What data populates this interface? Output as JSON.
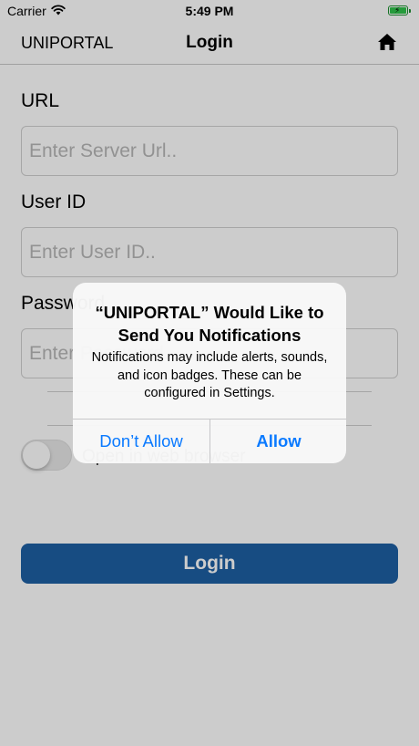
{
  "status_bar": {
    "carrier": "Carrier",
    "time": "5:49 PM"
  },
  "nav": {
    "app_name": "UNIPORTAL",
    "title": "Login",
    "home_icon": "home-icon"
  },
  "form": {
    "url_label": "URL",
    "url_placeholder": "Enter Server Url..",
    "user_id_label": "User ID",
    "user_id_placeholder": "Enter User ID..",
    "password_label": "Password",
    "password_placeholder": "Enter Password..",
    "open_in_browser_label": "Open in web browser",
    "open_in_browser_on": false,
    "login_label": "Login"
  },
  "alert": {
    "title": "“UNIPORTAL” Would Like to Send You Notifications",
    "message": "Notifications may include alerts, sounds, and icon badges. These can be configured in Settings.",
    "dont_allow_label": "Don’t Allow",
    "allow_label": "Allow"
  },
  "colors": {
    "accent": "#0a7aff",
    "login_button": "#1d5fa3",
    "battery": "#2fc24a"
  }
}
